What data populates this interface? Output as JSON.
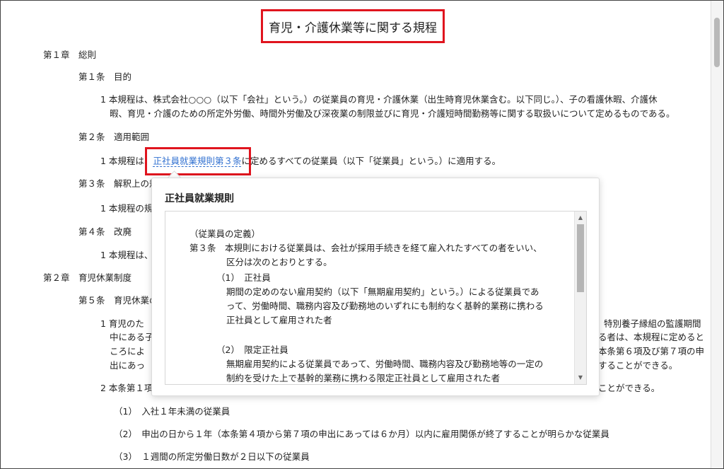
{
  "document": {
    "title": "育児・介護休業等に関する規程",
    "chapter1": "第１章　総則",
    "art1": {
      "heading": "第１条　目的",
      "p1_line1": "1  本規程は、株式会社○○○（以下「会社」という。）の従業員の育児・介護休業（出生時育児休業含む。以下同じ。）、子の看護休暇、介護休",
      "p1_line2": "暇、育児・介護のための所定外労働、時間外労働及び深夜業の制限並びに育児・介護短時間勤務等に関する取扱いについて定めるものである。"
    },
    "art2": {
      "heading": "第２条　適用範囲",
      "p1_prefix": "1  本規程は、",
      "p1_link": "正社員就業規則第３条",
      "p1_suffix": "に定めるすべての従業員（以下「従業員」という。）に適用する。"
    },
    "art3": {
      "heading": "第３条　解釈上の規",
      "p1": "1  本規程の規"
    },
    "art4": {
      "heading": "第４条　改廃",
      "p1": "1  本規程は、"
    },
    "chapter2": "第２章　育児休業制度",
    "art5": {
      "heading": "第５条　育児休業の",
      "p1_l1_left": "1  育児のた",
      "p1_l1_right": "特別養子縁組の監護期間",
      "p1_l2_left": "中にある子",
      "p1_l2_right": "る者は、本規程に定めると",
      "p1_l3_left": "ころによ",
      "p1_l3_right": "本条第６項及び第７項の申",
      "p1_l4_left": "出にあっ",
      "p1_l4_right": "することができる。",
      "p2_left": "2  本条第１項",
      "p2_right": "ことができる。",
      "item1": "（1）　入社１年未満の従業員",
      "item2": "（2）　申出の日から１年（本条第４項から第７項の申出にあっては６か月）以内に雇用関係が終了することが明らかな従業員",
      "item3": "（3）　１週間の所定労働日数が２日以下の従業員"
    }
  },
  "popup": {
    "title": "正社員就業規則",
    "lines": {
      "l1": "（従業員の定義）",
      "l2": "第３条　本規則における従業員は、会社が採用手続きを経て雇入れたすべての者をいい、",
      "l3": "区分は次のとおりとする。",
      "l4": "（1）　正社員",
      "l5": "期間の定めのない雇用契約（以下「無期雇用契約」という。）による従業員であ",
      "l6": "って、労働時間、職務内容及び勤務地のいずれにも制約なく基幹的業務に携わる",
      "l7": "正社員として雇用された者",
      "l8": "（2）　限定正社員",
      "l9": "無期雇用契約による従業員であって、労働時間、職務内容及び勤務地等の一定の",
      "l10": "制約を受けた上で基幹的業務に携わる限定正社員として雇用された者"
    }
  },
  "icons": {
    "scroll_up": "▲",
    "scroll_down": "▼"
  },
  "colors": {
    "highlight": "#e0141e",
    "link": "#2f6fd0"
  }
}
